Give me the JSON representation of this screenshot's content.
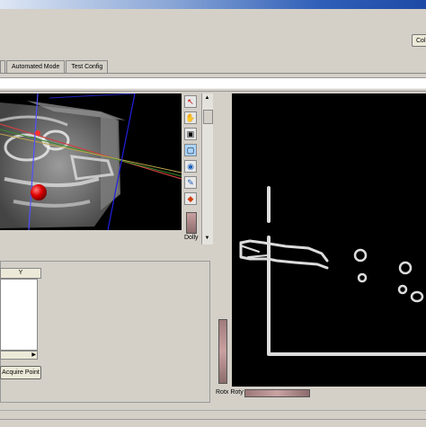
{
  "header": {
    "column_button_label": "Col"
  },
  "tabs": [
    {
      "label": ""
    },
    {
      "label": "Automated Mode"
    },
    {
      "label": "Test Config"
    }
  ],
  "view3d_tools": [
    {
      "icon": "select-arrow-icon",
      "glyph": "↖"
    },
    {
      "icon": "hand-pan-icon",
      "glyph": "✋"
    },
    {
      "icon": "camera-icon",
      "glyph": "▣"
    },
    {
      "icon": "zoom-box-icon",
      "glyph": "▢"
    },
    {
      "icon": "eye-icon",
      "glyph": "◉"
    },
    {
      "icon": "paint-brush-icon",
      "glyph": "✎"
    },
    {
      "icon": "cube-icon",
      "glyph": "◆"
    }
  ],
  "view3d": {
    "mode_label": "Dolly"
  },
  "table": {
    "column_y": "Y"
  },
  "acquire_button_label": "Acquire Point",
  "view2d": {
    "rotation_label": "Rotx Roty"
  }
}
